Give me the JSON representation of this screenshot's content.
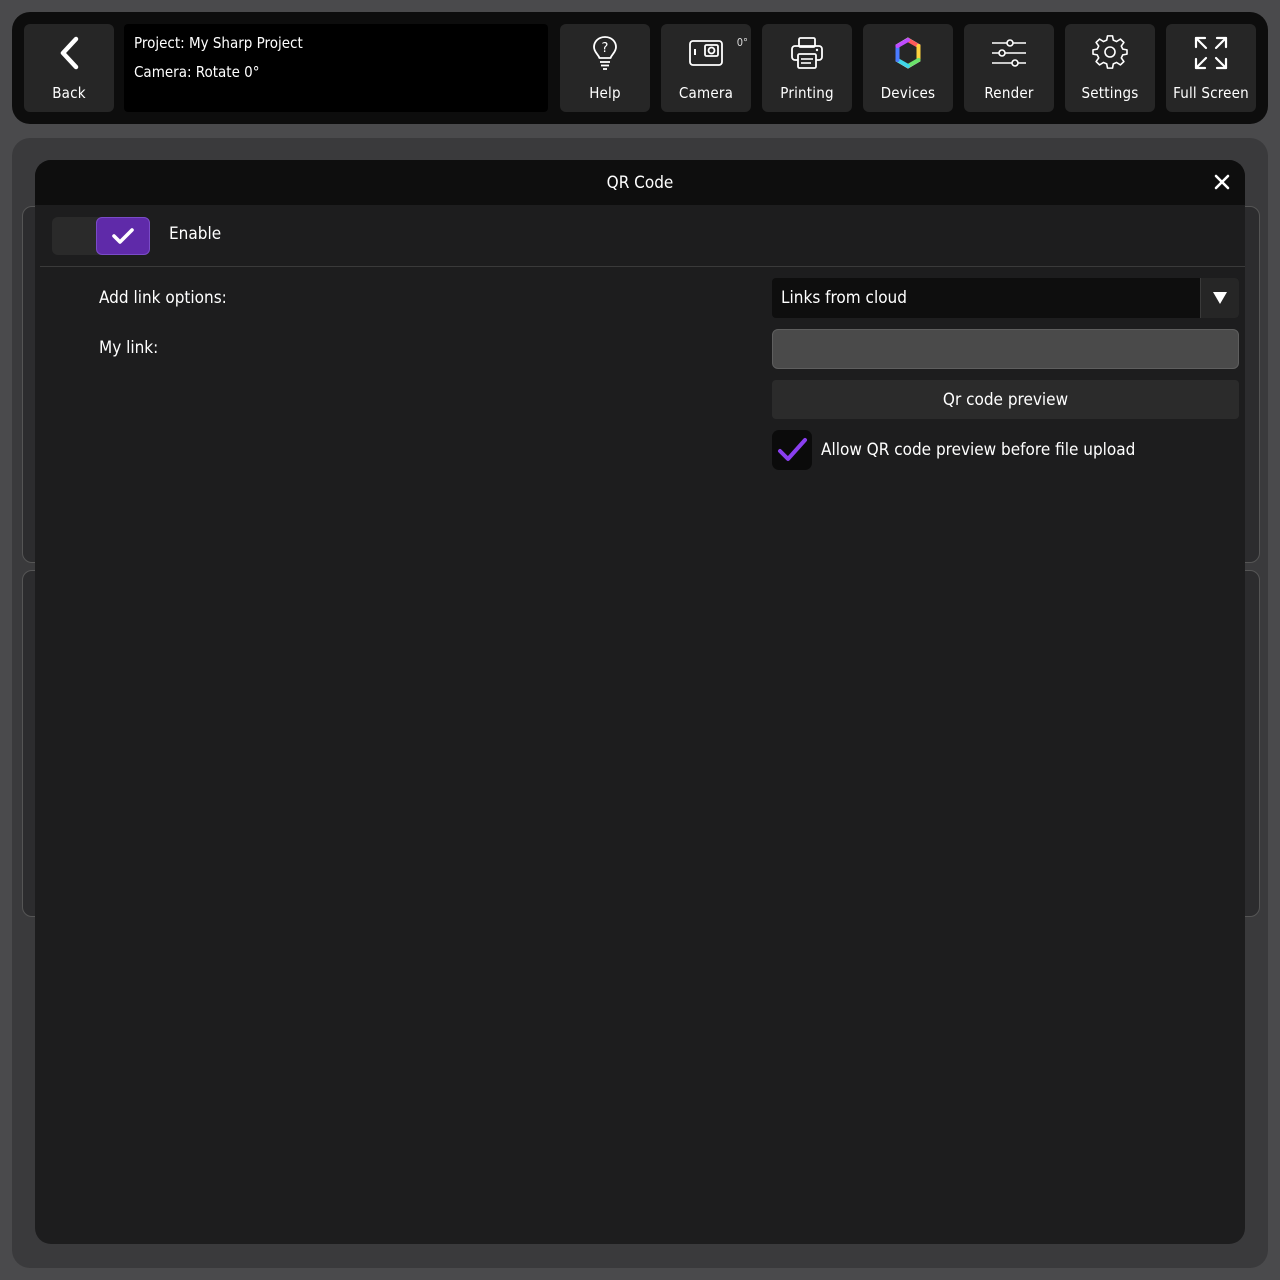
{
  "toolbar": {
    "back_label": "Back",
    "project_line": "Project: My Sharp Project",
    "camera_line": "Camera: Rotate 0°",
    "buttons": {
      "help": "Help",
      "camera": "Camera",
      "camera_badge": "0°",
      "printing": "Printing",
      "devices": "Devices",
      "render": "Render",
      "settings": "Settings",
      "fullscreen": "Full Screen"
    }
  },
  "modal": {
    "title": "QR Code",
    "enable_label": "Enable",
    "enable_checked": true,
    "link_options_label": "Add link options:",
    "link_options_value": "Links from cloud",
    "my_link_label": "My link:",
    "my_link_value": "",
    "preview_button": "Qr code preview",
    "allow_preview_label": "Allow QR code preview before file upload",
    "allow_preview_checked": true
  },
  "colors": {
    "accent": "#5f2aa9",
    "check_purple": "#8a3ff0"
  }
}
